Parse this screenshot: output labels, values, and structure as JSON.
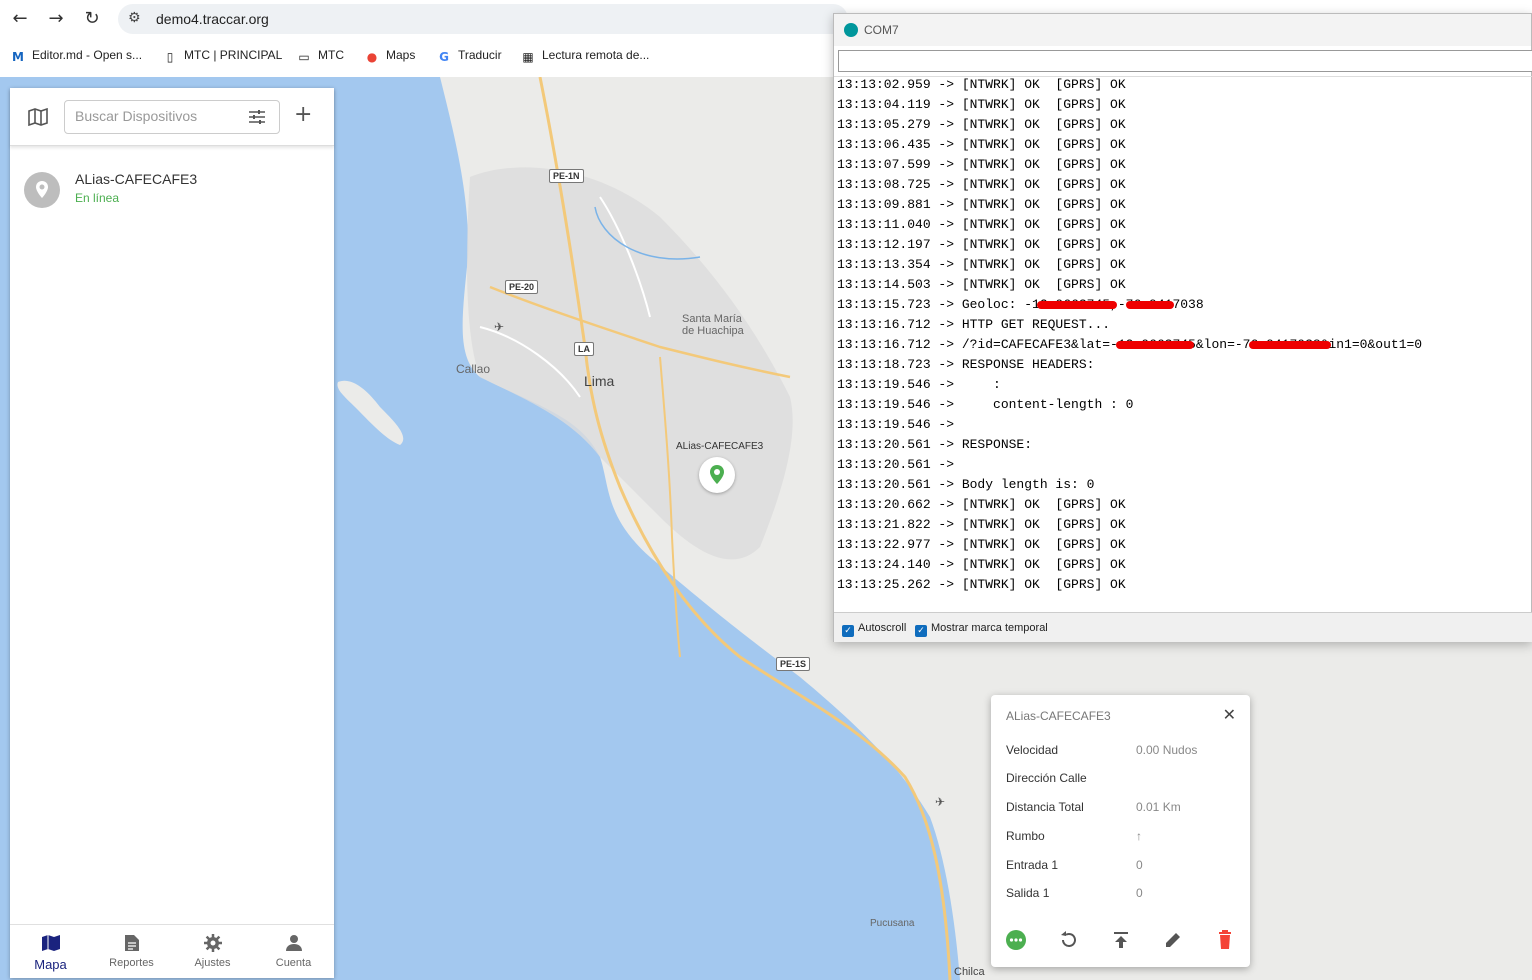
{
  "browser": {
    "url": "demo4.traccar.org",
    "bookmarks": [
      {
        "label": "Editor.md - Open s...",
        "icon": "markdown-icon"
      },
      {
        "label": "MTC | PRINCIPAL",
        "icon": "page-icon"
      },
      {
        "label": "MTC",
        "icon": "folder-icon"
      },
      {
        "label": "Maps",
        "icon": "maps-pin-icon"
      },
      {
        "label": "Traducir",
        "icon": "translate-icon"
      },
      {
        "label": "Lectura remota de...",
        "icon": "page-icon"
      }
    ]
  },
  "map": {
    "labels": {
      "callao": "Callao",
      "lima": "Lima",
      "santa_maria": "Santa María",
      "de_huachipa": "de Huachipa",
      "pucusana": "Pucusana",
      "chilca": "Chilca",
      "marker_label": "ALias-CAFECAFE3"
    },
    "shields": {
      "pe1n": "PE-1N",
      "pe20": "PE-20",
      "la": "LA",
      "pe1s": "PE-1S"
    }
  },
  "sidebar": {
    "search_placeholder": "Buscar Dispositivos",
    "device": {
      "name": "ALias-CAFECAFE3",
      "status": "En línea"
    },
    "nav": [
      {
        "label": "Mapa",
        "icon": "map-icon",
        "active": true
      },
      {
        "label": "Reportes",
        "icon": "document-icon",
        "active": false
      },
      {
        "label": "Ajustes",
        "icon": "gear-icon",
        "active": false
      },
      {
        "label": "Cuenta",
        "icon": "person-icon",
        "active": false
      }
    ]
  },
  "serial": {
    "title": "COM7",
    "lines": [
      "13:13:02.959 -> [NTWRK] OK  [GPRS] OK",
      "13:13:04.119 -> [NTWRK] OK  [GPRS] OK",
      "13:13:05.279 -> [NTWRK] OK  [GPRS] OK",
      "13:13:06.435 -> [NTWRK] OK  [GPRS] OK",
      "13:13:07.599 -> [NTWRK] OK  [GPRS] OK",
      "13:13:08.725 -> [NTWRK] OK  [GPRS] OK",
      "13:13:09.881 -> [NTWRK] OK  [GPRS] OK",
      "13:13:11.040 -> [NTWRK] OK  [GPRS] OK",
      "13:13:12.197 -> [NTWRK] OK  [GPRS] OK",
      "13:13:13.354 -> [NTWRK] OK  [GPRS] OK",
      "13:13:14.503 -> [NTWRK] OK  [GPRS] OK",
      "13:13:15.723 -> Geoloc: -12.0663745,-76.9417038",
      "13:13:16.712 -> HTTP GET REQUEST...",
      "13:13:16.712 -> /?id=CAFECAFE3&lat=-12.0663745&lon=-76.9417038&in1=0&out1=0",
      "13:13:18.723 -> RESPONSE HEADERS:",
      "13:13:19.546 ->     :",
      "13:13:19.546 ->     content-length : 0",
      "13:13:19.546 ->",
      "13:13:20.561 -> RESPONSE:",
      "13:13:20.561 ->",
      "13:13:20.561 -> Body length is: 0",
      "13:13:20.662 -> [NTWRK] OK  [GPRS] OK",
      "13:13:21.822 -> [NTWRK] OK  [GPRS] OK",
      "13:13:22.977 -> [NTWRK] OK  [GPRS] OK",
      "13:13:24.140 -> [NTWRK] OK  [GPRS] OK",
      "13:13:25.262 -> [NTWRK] OK  [GPRS] OK"
    ],
    "autoscroll_label": "Autoscroll",
    "timestamp_label": "Mostrar marca temporal"
  },
  "popup": {
    "title": "ALias-CAFECAFE3",
    "rows": [
      {
        "key": "Velocidad",
        "value": "0.00 Nudos"
      },
      {
        "key": "Dirección Calle",
        "value": ""
      },
      {
        "key": "Distancia Total",
        "value": "0.01 Km"
      },
      {
        "key": "Rumbo",
        "value": "↑"
      },
      {
        "key": "Entrada 1",
        "value": "0"
      },
      {
        "key": "Salida 1",
        "value": "0"
      }
    ]
  },
  "colors": {
    "sea": "#a3c8ef",
    "land": "#ebebe9",
    "online": "#4caf50",
    "delete": "#f44336",
    "nav_active": "#1a237e",
    "marker": "#4caf50"
  }
}
